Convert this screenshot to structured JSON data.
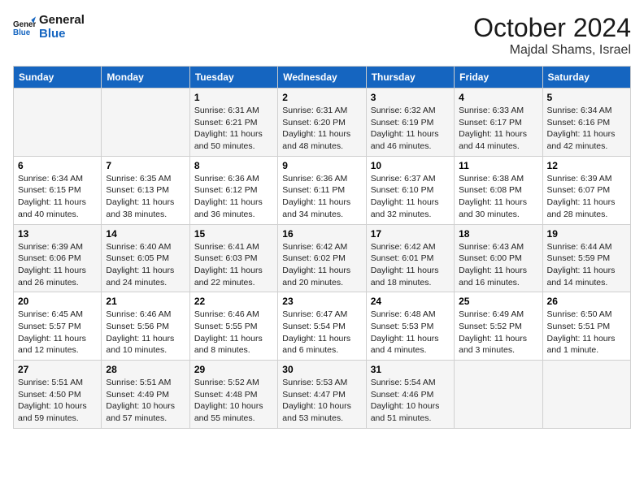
{
  "logo": {
    "line1": "General",
    "line2": "Blue"
  },
  "title": "October 2024",
  "location": "Majdal Shams, Israel",
  "days_of_week": [
    "Sunday",
    "Monday",
    "Tuesday",
    "Wednesday",
    "Thursday",
    "Friday",
    "Saturday"
  ],
  "weeks": [
    [
      {
        "day": "",
        "info": ""
      },
      {
        "day": "",
        "info": ""
      },
      {
        "day": "1",
        "info": "Sunrise: 6:31 AM\nSunset: 6:21 PM\nDaylight: 11 hours and 50 minutes."
      },
      {
        "day": "2",
        "info": "Sunrise: 6:31 AM\nSunset: 6:20 PM\nDaylight: 11 hours and 48 minutes."
      },
      {
        "day": "3",
        "info": "Sunrise: 6:32 AM\nSunset: 6:19 PM\nDaylight: 11 hours and 46 minutes."
      },
      {
        "day": "4",
        "info": "Sunrise: 6:33 AM\nSunset: 6:17 PM\nDaylight: 11 hours and 44 minutes."
      },
      {
        "day": "5",
        "info": "Sunrise: 6:34 AM\nSunset: 6:16 PM\nDaylight: 11 hours and 42 minutes."
      }
    ],
    [
      {
        "day": "6",
        "info": "Sunrise: 6:34 AM\nSunset: 6:15 PM\nDaylight: 11 hours and 40 minutes."
      },
      {
        "day": "7",
        "info": "Sunrise: 6:35 AM\nSunset: 6:13 PM\nDaylight: 11 hours and 38 minutes."
      },
      {
        "day": "8",
        "info": "Sunrise: 6:36 AM\nSunset: 6:12 PM\nDaylight: 11 hours and 36 minutes."
      },
      {
        "day": "9",
        "info": "Sunrise: 6:36 AM\nSunset: 6:11 PM\nDaylight: 11 hours and 34 minutes."
      },
      {
        "day": "10",
        "info": "Sunrise: 6:37 AM\nSunset: 6:10 PM\nDaylight: 11 hours and 32 minutes."
      },
      {
        "day": "11",
        "info": "Sunrise: 6:38 AM\nSunset: 6:08 PM\nDaylight: 11 hours and 30 minutes."
      },
      {
        "day": "12",
        "info": "Sunrise: 6:39 AM\nSunset: 6:07 PM\nDaylight: 11 hours and 28 minutes."
      }
    ],
    [
      {
        "day": "13",
        "info": "Sunrise: 6:39 AM\nSunset: 6:06 PM\nDaylight: 11 hours and 26 minutes."
      },
      {
        "day": "14",
        "info": "Sunrise: 6:40 AM\nSunset: 6:05 PM\nDaylight: 11 hours and 24 minutes."
      },
      {
        "day": "15",
        "info": "Sunrise: 6:41 AM\nSunset: 6:03 PM\nDaylight: 11 hours and 22 minutes."
      },
      {
        "day": "16",
        "info": "Sunrise: 6:42 AM\nSunset: 6:02 PM\nDaylight: 11 hours and 20 minutes."
      },
      {
        "day": "17",
        "info": "Sunrise: 6:42 AM\nSunset: 6:01 PM\nDaylight: 11 hours and 18 minutes."
      },
      {
        "day": "18",
        "info": "Sunrise: 6:43 AM\nSunset: 6:00 PM\nDaylight: 11 hours and 16 minutes."
      },
      {
        "day": "19",
        "info": "Sunrise: 6:44 AM\nSunset: 5:59 PM\nDaylight: 11 hours and 14 minutes."
      }
    ],
    [
      {
        "day": "20",
        "info": "Sunrise: 6:45 AM\nSunset: 5:57 PM\nDaylight: 11 hours and 12 minutes."
      },
      {
        "day": "21",
        "info": "Sunrise: 6:46 AM\nSunset: 5:56 PM\nDaylight: 11 hours and 10 minutes."
      },
      {
        "day": "22",
        "info": "Sunrise: 6:46 AM\nSunset: 5:55 PM\nDaylight: 11 hours and 8 minutes."
      },
      {
        "day": "23",
        "info": "Sunrise: 6:47 AM\nSunset: 5:54 PM\nDaylight: 11 hours and 6 minutes."
      },
      {
        "day": "24",
        "info": "Sunrise: 6:48 AM\nSunset: 5:53 PM\nDaylight: 11 hours and 4 minutes."
      },
      {
        "day": "25",
        "info": "Sunrise: 6:49 AM\nSunset: 5:52 PM\nDaylight: 11 hours and 3 minutes."
      },
      {
        "day": "26",
        "info": "Sunrise: 6:50 AM\nSunset: 5:51 PM\nDaylight: 11 hours and 1 minute."
      }
    ],
    [
      {
        "day": "27",
        "info": "Sunrise: 5:51 AM\nSunset: 4:50 PM\nDaylight: 10 hours and 59 minutes."
      },
      {
        "day": "28",
        "info": "Sunrise: 5:51 AM\nSunset: 4:49 PM\nDaylight: 10 hours and 57 minutes."
      },
      {
        "day": "29",
        "info": "Sunrise: 5:52 AM\nSunset: 4:48 PM\nDaylight: 10 hours and 55 minutes."
      },
      {
        "day": "30",
        "info": "Sunrise: 5:53 AM\nSunset: 4:47 PM\nDaylight: 10 hours and 53 minutes."
      },
      {
        "day": "31",
        "info": "Sunrise: 5:54 AM\nSunset: 4:46 PM\nDaylight: 10 hours and 51 minutes."
      },
      {
        "day": "",
        "info": ""
      },
      {
        "day": "",
        "info": ""
      }
    ]
  ]
}
